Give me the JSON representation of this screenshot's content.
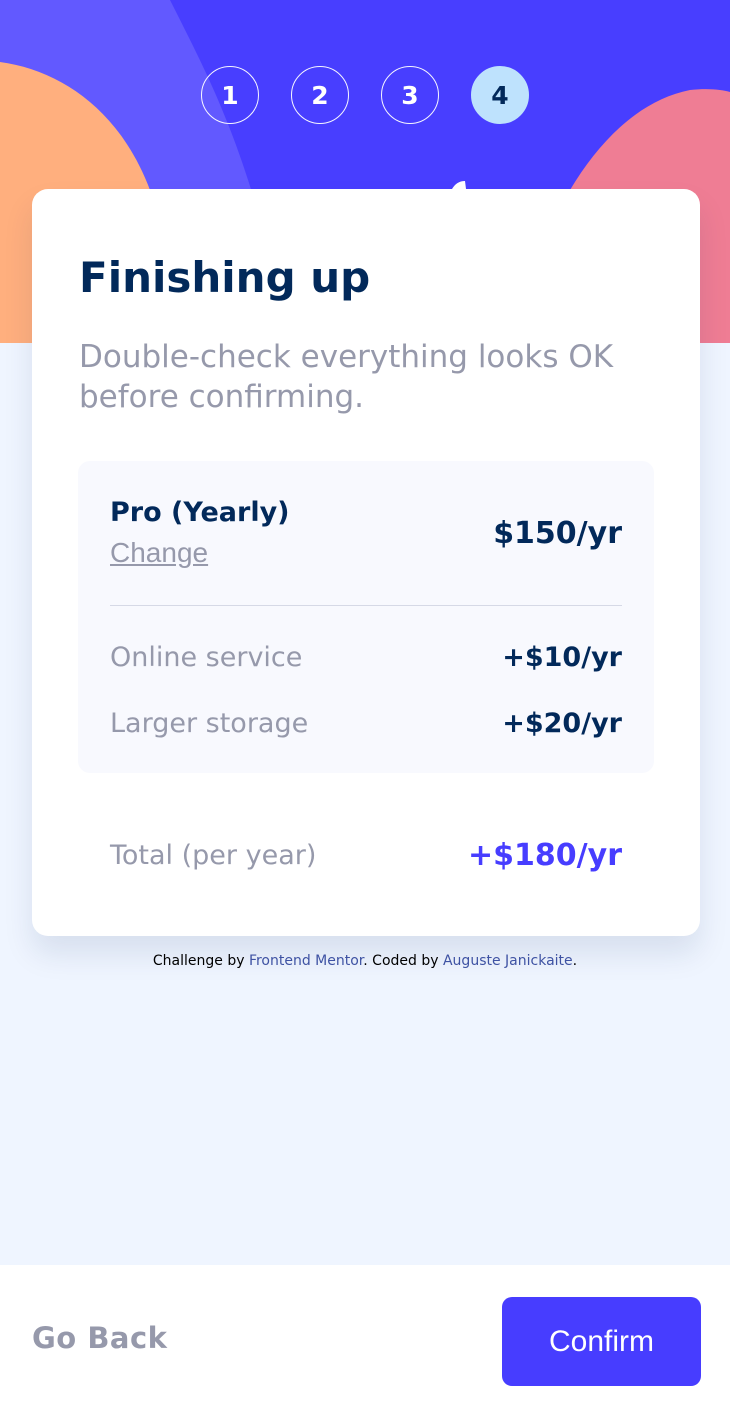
{
  "colors": {
    "header_blue": "#483eff",
    "header_light": "#6259ff",
    "blob_orange": "#ffaf7e",
    "blob_pink": "#f9818e",
    "page_bg": "#eff5ff",
    "marine_blue": "#02295a",
    "cool_gray": "#9699ab",
    "purplish_blue": "#473dff",
    "active_step_bg": "#bee2fd"
  },
  "steps": [
    "1",
    "2",
    "3",
    "4"
  ],
  "active_step": "4",
  "card": {
    "title": "Finishing up",
    "subtitle": "Double-check everything looks OK before confirming."
  },
  "summary": {
    "plan_name": "Pro (Yearly)",
    "change_label": "Change",
    "plan_price": "$150/yr",
    "addons": [
      {
        "name": "Online service",
        "price": "+$10/yr"
      },
      {
        "name": "Larger storage",
        "price": "+$20/yr"
      }
    ]
  },
  "total": {
    "label": "Total (per year)",
    "price": "+$180/yr"
  },
  "attribution": {
    "prefix": "Challenge by ",
    "link1": "Frontend Mentor",
    "middle": ". Coded by ",
    "link2": "Auguste Janickaite",
    "suffix": "."
  },
  "footer": {
    "back_label": "Go Back",
    "confirm_label": "Confirm"
  }
}
